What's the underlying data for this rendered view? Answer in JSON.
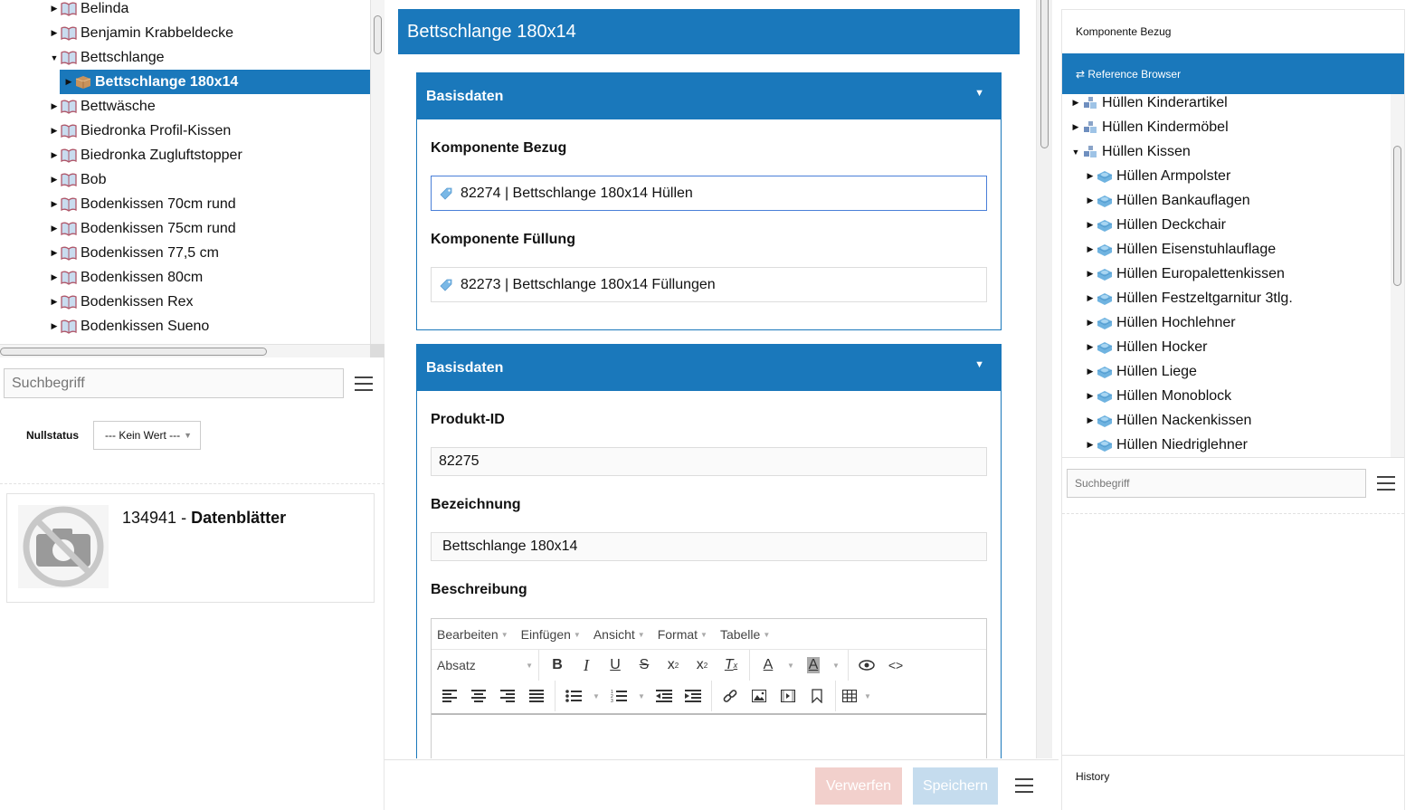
{
  "left_tree": {
    "items": [
      {
        "label": "Belinda",
        "level": 1,
        "expanded": false,
        "icon": "catalog-book-icon",
        "selected": false
      },
      {
        "label": "Benjamin Krabbeldecke",
        "level": 1,
        "expanded": false,
        "icon": "catalog-book-icon",
        "selected": false
      },
      {
        "label": "Bettschlange",
        "level": 1,
        "expanded": true,
        "icon": "catalog-book-icon",
        "selected": false
      },
      {
        "label": "Bettschlange 180x14",
        "level": 2,
        "expanded": false,
        "icon": "product-box-icon",
        "selected": true
      },
      {
        "label": "Bettwäsche",
        "level": 1,
        "expanded": false,
        "icon": "catalog-book-icon",
        "selected": false
      },
      {
        "label": "Biedronka Profil-Kissen",
        "level": 1,
        "expanded": false,
        "icon": "catalog-book-icon",
        "selected": false
      },
      {
        "label": "Biedronka Zugluftstopper",
        "level": 1,
        "expanded": false,
        "icon": "catalog-book-icon",
        "selected": false
      },
      {
        "label": "Bob",
        "level": 1,
        "expanded": false,
        "icon": "catalog-book-icon",
        "selected": false
      },
      {
        "label": "Bodenkissen 70cm rund",
        "level": 1,
        "expanded": false,
        "icon": "catalog-book-icon",
        "selected": false
      },
      {
        "label": "Bodenkissen 75cm rund",
        "level": 1,
        "expanded": false,
        "icon": "catalog-book-icon",
        "selected": false
      },
      {
        "label": "Bodenkissen 77,5 cm",
        "level": 1,
        "expanded": false,
        "icon": "catalog-book-icon",
        "selected": false
      },
      {
        "label": "Bodenkissen 80cm",
        "level": 1,
        "expanded": false,
        "icon": "catalog-book-icon",
        "selected": false
      },
      {
        "label": "Bodenkissen Rex",
        "level": 1,
        "expanded": false,
        "icon": "catalog-book-icon",
        "selected": false
      },
      {
        "label": "Bodenkissen Sueno",
        "level": 1,
        "expanded": false,
        "icon": "catalog-book-icon",
        "selected": false
      }
    ]
  },
  "left_search": {
    "placeholder": "Suchbegriff",
    "value": ""
  },
  "nullstatus": {
    "label": "Nullstatus",
    "selected": "--- Kein Wert ---"
  },
  "asset_card": {
    "id": "134941",
    "separator": " - ",
    "name": "Datenblätter",
    "thumbnail": "no-image-camera-icon"
  },
  "center": {
    "header_title": "Bettschlange 180x14",
    "sections": [
      {
        "title": "Basisdaten",
        "fields": [
          {
            "label": "Komponente Bezug",
            "value": "82274 | Bettschlange 180x14 Hüllen",
            "type": "reference"
          },
          {
            "label": "Komponente Füllung",
            "value": "82273 | Bettschlange 180x14 Füllungen",
            "type": "reference"
          }
        ]
      },
      {
        "title": "Basisdaten",
        "fields": [
          {
            "label": "Produkt-ID",
            "value": "82275",
            "type": "text"
          },
          {
            "label": "Bezeichnung",
            "value": "Bettschlange 180x14",
            "type": "text"
          },
          {
            "label": "Beschreibung",
            "value": "",
            "type": "richtext"
          }
        ]
      }
    ],
    "editor": {
      "menus": [
        "Bearbeiten",
        "Einfügen",
        "Ansicht",
        "Format",
        "Tabelle"
      ],
      "block_format": "Absatz"
    },
    "footer": {
      "discard_label": "Verwerfen",
      "save_label": "Speichern"
    }
  },
  "right": {
    "title": "Komponente Bezug",
    "browser_tab_label": "⇄ Reference Browser",
    "tree": [
      {
        "label": "Hüllen Kinderartikel",
        "level": 1,
        "expanded": false,
        "icon": "category-cubes-icon"
      },
      {
        "label": "Hüllen Kindermöbel",
        "level": 1,
        "expanded": false,
        "icon": "category-cubes-icon"
      },
      {
        "label": "Hüllen Kissen",
        "level": 1,
        "expanded": true,
        "icon": "category-cubes-icon"
      },
      {
        "label": "Hüllen Armpolster",
        "level": 2,
        "expanded": false,
        "icon": "component-brick-icon"
      },
      {
        "label": "Hüllen Bankauflagen",
        "level": 2,
        "expanded": false,
        "icon": "component-brick-icon"
      },
      {
        "label": "Hüllen Deckchair",
        "level": 2,
        "expanded": false,
        "icon": "component-brick-icon"
      },
      {
        "label": "Hüllen Eisenstuhlauflage",
        "level": 2,
        "expanded": false,
        "icon": "component-brick-icon"
      },
      {
        "label": "Hüllen Europalettenkissen",
        "level": 2,
        "expanded": false,
        "icon": "component-brick-icon"
      },
      {
        "label": "Hüllen Festzeltgarnitur 3tlg.",
        "level": 2,
        "expanded": false,
        "icon": "component-brick-icon"
      },
      {
        "label": "Hüllen Hochlehner",
        "level": 2,
        "expanded": false,
        "icon": "component-brick-icon"
      },
      {
        "label": "Hüllen Hocker",
        "level": 2,
        "expanded": false,
        "icon": "component-brick-icon"
      },
      {
        "label": "Hüllen Liege",
        "level": 2,
        "expanded": false,
        "icon": "component-brick-icon"
      },
      {
        "label": "Hüllen Monoblock",
        "level": 2,
        "expanded": false,
        "icon": "component-brick-icon"
      },
      {
        "label": "Hüllen Nackenkissen",
        "level": 2,
        "expanded": false,
        "icon": "component-brick-icon"
      },
      {
        "label": "Hüllen Niedriglehner",
        "level": 2,
        "expanded": false,
        "icon": "component-brick-icon"
      }
    ],
    "search": {
      "placeholder": "Suchbegriff",
      "value": ""
    },
    "history_label": "History"
  },
  "colors": {
    "accent": "#1a78bb",
    "discard_disabled": "#f2d0cc",
    "save_disabled": "#c5dcee"
  }
}
